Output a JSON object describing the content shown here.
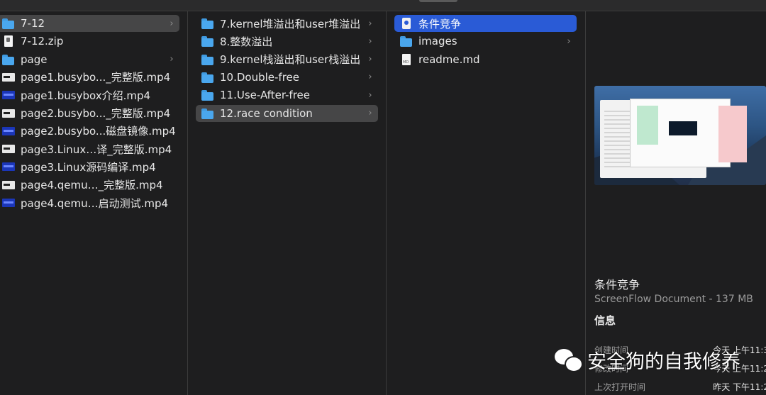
{
  "column1": [
    {
      "label": "7-12",
      "icon": "folder-icon",
      "chevron": true,
      "selected": "gray"
    },
    {
      "label": "7-12.zip",
      "icon": "doc-icon",
      "chevron": false,
      "selected": ""
    },
    {
      "label": "page",
      "icon": "folder-icon",
      "chevron": true,
      "selected": ""
    },
    {
      "label": "page1.busybo..._完整版.mp4",
      "icon": "video-icon",
      "chevron": false,
      "selected": ""
    },
    {
      "label": "page1.busybox介绍.mp4",
      "icon": "video-blue-icon",
      "chevron": false,
      "selected": ""
    },
    {
      "label": "page2.busybo..._完整版.mp4",
      "icon": "video-icon",
      "chevron": false,
      "selected": ""
    },
    {
      "label": "page2.busybo...磁盘镜像.mp4",
      "icon": "video-blue-icon",
      "chevron": false,
      "selected": ""
    },
    {
      "label": "page3.Linux…译_完整版.mp4",
      "icon": "video-icon",
      "chevron": false,
      "selected": ""
    },
    {
      "label": "page3.Linux源码编译.mp4",
      "icon": "video-blue-icon",
      "chevron": false,
      "selected": ""
    },
    {
      "label": "page4.qemu…_完整版.mp4",
      "icon": "video-icon",
      "chevron": false,
      "selected": ""
    },
    {
      "label": "page4.qemu…启动测试.mp4",
      "icon": "video-blue-icon",
      "chevron": false,
      "selected": ""
    }
  ],
  "column2": [
    {
      "label": "7.kernel堆溢出和user堆溢出",
      "icon": "folder-icon",
      "chevron": true,
      "selected": ""
    },
    {
      "label": "8.整数溢出",
      "icon": "folder-icon",
      "chevron": true,
      "selected": ""
    },
    {
      "label": "9.kernel栈溢出和user栈溢出",
      "icon": "folder-icon",
      "chevron": true,
      "selected": ""
    },
    {
      "label": "10.Double-free",
      "icon": "folder-icon",
      "chevron": true,
      "selected": ""
    },
    {
      "label": "11.Use-After-free",
      "icon": "folder-icon",
      "chevron": true,
      "selected": ""
    },
    {
      "label": "12.race condition",
      "icon": "folder-icon",
      "chevron": true,
      "selected": "gray"
    }
  ],
  "column3": [
    {
      "label": "条件竞争",
      "icon": "screenflow-icon",
      "chevron": false,
      "selected": "blue"
    },
    {
      "label": "images",
      "icon": "folder-icon",
      "chevron": true,
      "selected": ""
    },
    {
      "label": "readme.md",
      "icon": "md-icon",
      "chevron": false,
      "selected": ""
    }
  ],
  "preview": {
    "title": "条件竞争",
    "subtitle": "ScreenFlow Document - 137 MB",
    "info_heading": "信息",
    "rows": [
      {
        "label": "创建时间",
        "value": "今天 上午11:3"
      },
      {
        "label": "修改时间",
        "value": "今天 上午11:2"
      },
      {
        "label": "上次打开时间",
        "value": "昨天 下午11:2"
      }
    ]
  },
  "watermark": {
    "text": "安全狗的自我修养"
  }
}
